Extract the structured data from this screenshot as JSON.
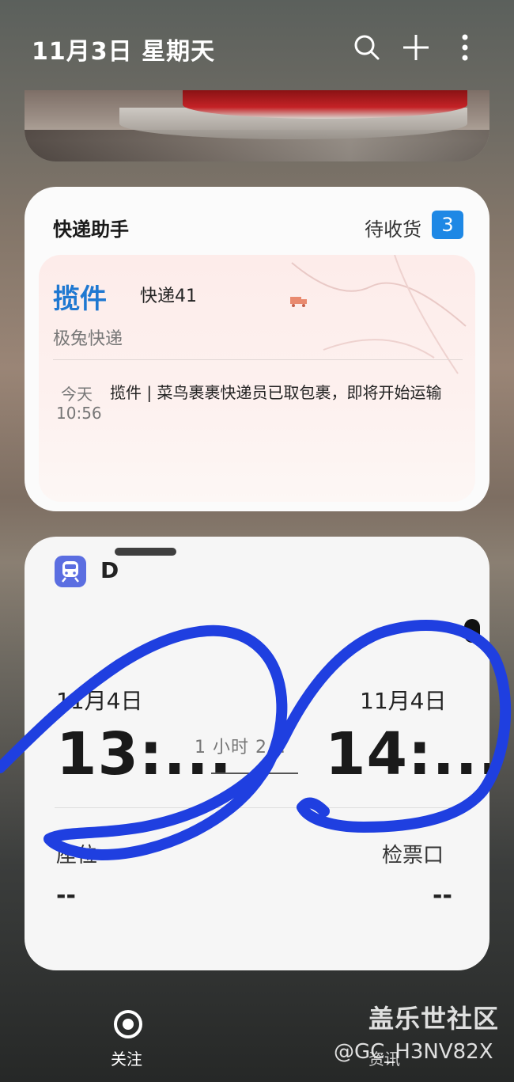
{
  "header": {
    "date": "11月3日 星期天",
    "icons": [
      "search-icon",
      "add-icon",
      "more-vertical-icon"
    ]
  },
  "express": {
    "title": "快递助手",
    "pending_label": "待收货",
    "pending_count": "3",
    "status": "揽件",
    "company": "快递41",
    "sender": "极兔快递",
    "event_day": "今天",
    "event_time": "10:56",
    "event_message": "揽件 | 菜鸟裹裹快递员已取包裹，即将开始运输"
  },
  "train": {
    "title": "D",
    "departure_date": "11月4日",
    "arrival_date": "11月4日",
    "departure_time": "13:...",
    "arrival_time": "14:...",
    "duration": "1 小时 2...",
    "seat_label": "座位",
    "seat_value": "--",
    "gate_label": "检票口",
    "gate_value": "--",
    "accent_color": "#5b6ee1"
  },
  "nav": {
    "follow_label": "关注",
    "news_label": "资讯"
  },
  "watermark": {
    "line1": "盖乐世社区",
    "line2": "@GC_H3NV82X"
  },
  "colors": {
    "accent_blue": "#1f78d1",
    "badge_blue": "#1e88e5",
    "scribble_blue": "#1f3fe0"
  }
}
